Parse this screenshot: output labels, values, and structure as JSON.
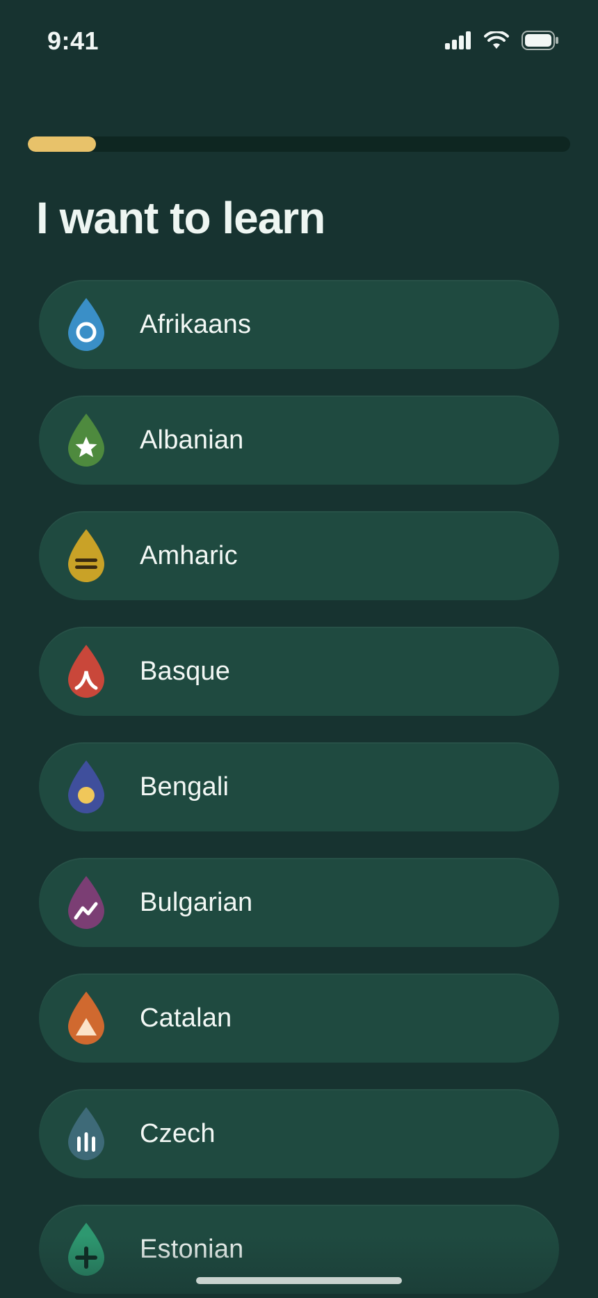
{
  "status_bar": {
    "time": "9:41",
    "icons": [
      "cellular-signal-icon",
      "wifi-icon",
      "battery-icon"
    ]
  },
  "onboarding": {
    "progress": 0.125,
    "progress_color": "#e8c26a",
    "title": "I want to learn"
  },
  "languages": [
    {
      "label": "Afrikaans",
      "icon": "circle-drop-icon",
      "color": "#3a8fc7"
    },
    {
      "label": "Albanian",
      "icon": "star-drop-icon",
      "color": "#4e8a3e"
    },
    {
      "label": "Amharic",
      "icon": "equals-drop-icon",
      "color": "#c9a227"
    },
    {
      "label": "Basque",
      "icon": "caret-drop-icon",
      "color": "#c9473a"
    },
    {
      "label": "Bengali",
      "icon": "dot-drop-icon",
      "color": "#3f4f9c"
    },
    {
      "label": "Bulgarian",
      "icon": "zigzag-drop-icon",
      "color": "#7b3e74"
    },
    {
      "label": "Catalan",
      "icon": "triangle-drop-icon",
      "color": "#d0692f"
    },
    {
      "label": "Czech",
      "icon": "bars-drop-icon",
      "color": "#3e6a78"
    },
    {
      "label": "Estonian",
      "icon": "plus-drop-icon",
      "color": "#2e9870"
    }
  ]
}
